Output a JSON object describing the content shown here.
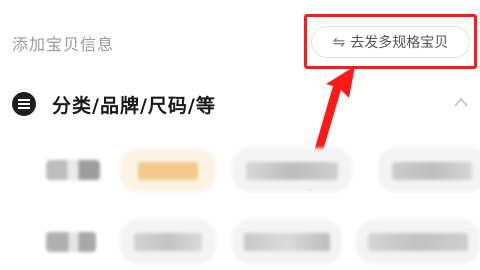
{
  "header": {
    "title": "添加宝贝信息"
  },
  "multi_spec_button": {
    "icon": "swap-icon",
    "label": "去发多规格宝贝"
  },
  "section": {
    "icon": "list-icon",
    "title": "分类/品牌/尺码/等",
    "collapse_icon": "chevron-up-icon"
  },
  "colors": {
    "highlight": "#ff1a1a",
    "selected_chip": "#f2c98a"
  }
}
